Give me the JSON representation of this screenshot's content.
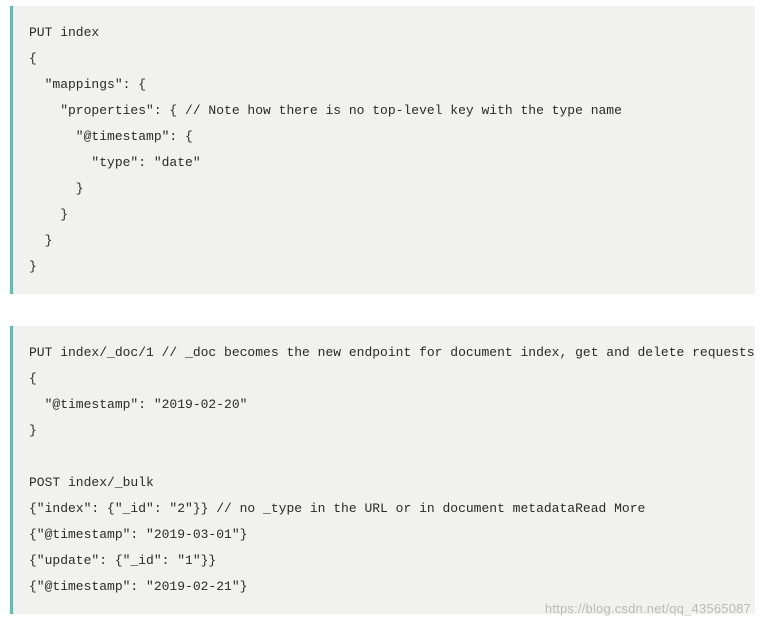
{
  "blocks": [
    {
      "code": "PUT index\n{\n  \"mappings\": {\n    \"properties\": { // Note how there is no top-level key with the type name\n      \"@timestamp\": {\n        \"type\": \"date\"\n      }\n    }\n  }\n}"
    },
    {
      "code": "PUT index/_doc/1 // _doc becomes the new endpoint for document index, get and delete requests\n{\n  \"@timestamp\": \"2019-02-20\"\n}\n\nPOST index/_bulk\n{\"index\": {\"_id\": \"2\"}} // no _type in the URL or in document metadataRead More\n{\"@timestamp\": \"2019-03-01\"}\n{\"update\": {\"_id\": \"1\"}}\n{\"@timestamp\": \"2019-02-21\"}"
    }
  ],
  "watermark": "https://blog.csdn.net/qq_43565087"
}
